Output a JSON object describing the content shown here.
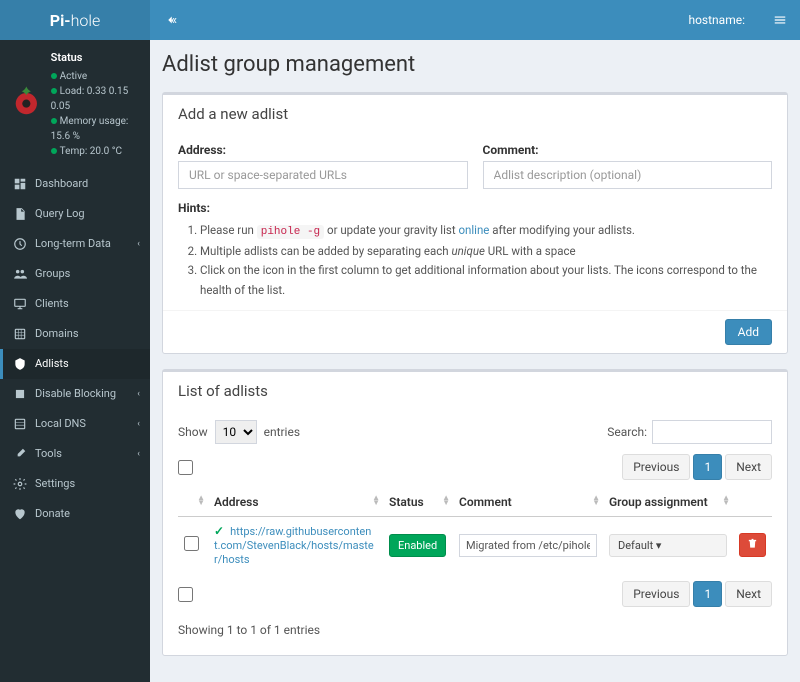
{
  "brand": {
    "prefix": "Pi-",
    "suffix": "hole"
  },
  "topbar": {
    "hostname_label": "hostname:"
  },
  "status": {
    "title": "Status",
    "active": "Active",
    "load": "Load: 0.33 0.15 0.05",
    "memory": "Memory usage: 15.6 %",
    "temp": "Temp: 20.0 °C"
  },
  "nav": {
    "dashboard": "Dashboard",
    "querylog": "Query Log",
    "longterm": "Long-term Data",
    "groups": "Groups",
    "clients": "Clients",
    "domains": "Domains",
    "adlists": "Adlists",
    "disable": "Disable Blocking",
    "localdns": "Local DNS",
    "tools": "Tools",
    "settings": "Settings",
    "donate": "Donate"
  },
  "page": {
    "title": "Adlist group management"
  },
  "addbox": {
    "title": "Add a new adlist",
    "address_label": "Address:",
    "address_placeholder": "URL or space-separated URLs",
    "comment_label": "Comment:",
    "comment_placeholder": "Adlist description (optional)",
    "hints_title": "Hints:",
    "hint1a": "Please run ",
    "hint1_code": "pihole -g",
    "hint1b": " or update your gravity list ",
    "hint1_link": "online",
    "hint1c": " after modifying your adlists.",
    "hint2a": "Multiple adlists can be added by separating each ",
    "hint2_em": "unique",
    "hint2b": " URL with a space",
    "hint3": "Click on the icon in the first column to get additional information about your lists. The icons correspond to the health of the list.",
    "add_btn": "Add"
  },
  "listbox": {
    "title": "List of adlists",
    "show": "Show",
    "entries": "entries",
    "length_value": "10",
    "search": "Search:",
    "col_address": "Address",
    "col_status": "Status",
    "col_comment": "Comment",
    "col_group": "Group assignment",
    "row0": {
      "address": "https://raw.githubusercontent.com/StevenBlack/hosts/master/hosts",
      "status": "Enabled",
      "comment": "Migrated from /etc/pihole/a",
      "group": "Default"
    },
    "previous": "Previous",
    "next": "Next",
    "page": "1",
    "info": "Showing 1 to 1 of 1 entries"
  }
}
